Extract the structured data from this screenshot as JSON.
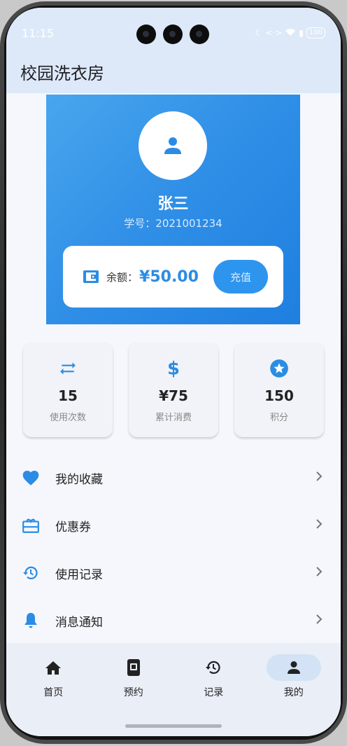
{
  "status_bar": {
    "time": "11:15",
    "battery": "100"
  },
  "header": {
    "title": "校园洗衣房"
  },
  "profile": {
    "name": "张三",
    "student_id": "学号：2021001234",
    "balance_label": "余额：",
    "balance_value": "¥50.00",
    "recharge_label": "充值"
  },
  "stats": [
    {
      "value": "15",
      "label": "使用次数",
      "icon": "repeat-icon"
    },
    {
      "value": "¥75",
      "label": "累计消费",
      "icon": "dollar-icon"
    },
    {
      "value": "150",
      "label": "积分",
      "icon": "star-icon"
    }
  ],
  "menu": [
    {
      "label": "我的收藏",
      "icon": "heart-icon"
    },
    {
      "label": "优惠券",
      "icon": "coupon-icon"
    },
    {
      "label": "使用记录",
      "icon": "history-icon"
    },
    {
      "label": "消息通知",
      "icon": "bell-icon"
    }
  ],
  "nav": [
    {
      "label": "首页",
      "icon": "home-icon"
    },
    {
      "label": "预约",
      "icon": "booking-icon"
    },
    {
      "label": "记录",
      "icon": "history-icon"
    },
    {
      "label": "我的",
      "icon": "person-icon",
      "active": true
    }
  ],
  "colors": {
    "accent": "#2e95ee",
    "header_bg": "#dde9f8",
    "card_gradient_start": "#48a6ee",
    "card_gradient_end": "#1f7fe0"
  }
}
